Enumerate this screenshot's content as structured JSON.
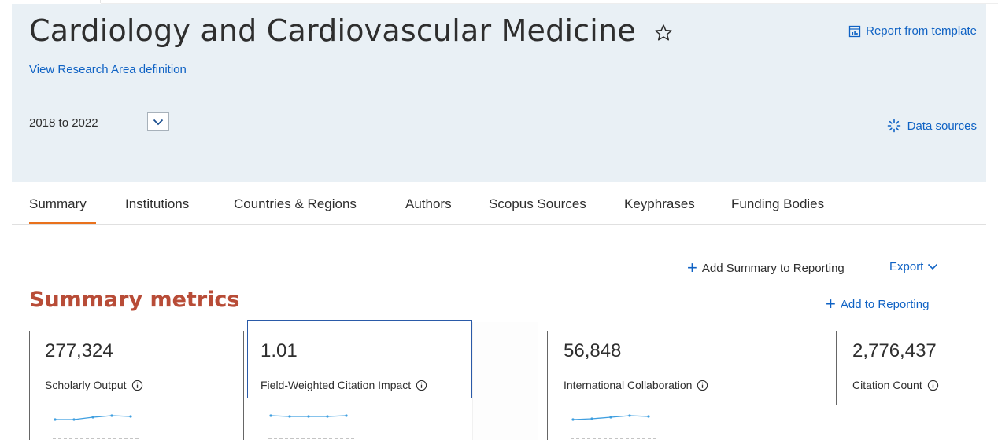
{
  "header": {
    "title": "Cardiology and Cardiovascular Medicine",
    "definition_link": "View Research Area definition",
    "report_link": "Report from template",
    "period_value": "2018 to 2022",
    "data_sources_link": "Data sources"
  },
  "tabs": [
    {
      "label": "Summary"
    },
    {
      "label": "Institutions"
    },
    {
      "label": "Countries & Regions"
    },
    {
      "label": "Authors"
    },
    {
      "label": "Scopus Sources"
    },
    {
      "label": "Keyphrases"
    },
    {
      "label": "Funding Bodies"
    }
  ],
  "actions": {
    "add_summary": "Add Summary to Reporting",
    "export": "Export",
    "add_reporting": "Add to Reporting"
  },
  "section": {
    "title": "Summary metrics"
  },
  "metrics": [
    {
      "value": "277,324",
      "label": "Scholarly Output"
    },
    {
      "value": "1.01",
      "label": "Field-Weighted Citation Impact"
    },
    {
      "value": "56,848",
      "label": "International Collaboration"
    },
    {
      "value": "2,776,437",
      "label": "Citation Count"
    }
  ],
  "colors": {
    "link": "#0f62c4",
    "accent": "#e9711c",
    "section_title": "#b84c37",
    "header_bg": "#e9f0f5",
    "sparkline": "#3f9fe0"
  },
  "icons": [
    "star-icon",
    "report-template-icon",
    "chevron-down-icon",
    "data-sources-icon",
    "plus-icon",
    "info-icon"
  ]
}
